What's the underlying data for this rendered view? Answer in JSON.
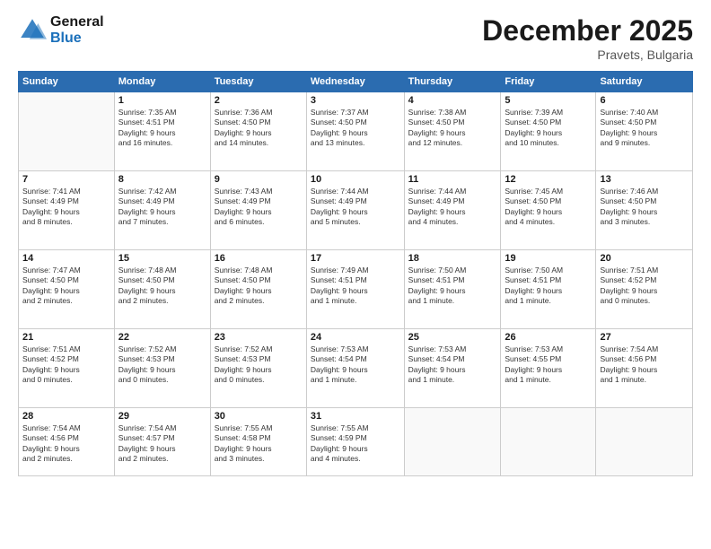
{
  "logo": {
    "line1": "General",
    "line2": "Blue"
  },
  "header": {
    "month_year": "December 2025",
    "location": "Pravets, Bulgaria"
  },
  "weekdays": [
    "Sunday",
    "Monday",
    "Tuesday",
    "Wednesday",
    "Thursday",
    "Friday",
    "Saturday"
  ],
  "weeks": [
    [
      {
        "day": "",
        "info": ""
      },
      {
        "day": "1",
        "info": "Sunrise: 7:35 AM\nSunset: 4:51 PM\nDaylight: 9 hours\nand 16 minutes."
      },
      {
        "day": "2",
        "info": "Sunrise: 7:36 AM\nSunset: 4:50 PM\nDaylight: 9 hours\nand 14 minutes."
      },
      {
        "day": "3",
        "info": "Sunrise: 7:37 AM\nSunset: 4:50 PM\nDaylight: 9 hours\nand 13 minutes."
      },
      {
        "day": "4",
        "info": "Sunrise: 7:38 AM\nSunset: 4:50 PM\nDaylight: 9 hours\nand 12 minutes."
      },
      {
        "day": "5",
        "info": "Sunrise: 7:39 AM\nSunset: 4:50 PM\nDaylight: 9 hours\nand 10 minutes."
      },
      {
        "day": "6",
        "info": "Sunrise: 7:40 AM\nSunset: 4:50 PM\nDaylight: 9 hours\nand 9 minutes."
      }
    ],
    [
      {
        "day": "7",
        "info": "Sunrise: 7:41 AM\nSunset: 4:49 PM\nDaylight: 9 hours\nand 8 minutes."
      },
      {
        "day": "8",
        "info": "Sunrise: 7:42 AM\nSunset: 4:49 PM\nDaylight: 9 hours\nand 7 minutes."
      },
      {
        "day": "9",
        "info": "Sunrise: 7:43 AM\nSunset: 4:49 PM\nDaylight: 9 hours\nand 6 minutes."
      },
      {
        "day": "10",
        "info": "Sunrise: 7:44 AM\nSunset: 4:49 PM\nDaylight: 9 hours\nand 5 minutes."
      },
      {
        "day": "11",
        "info": "Sunrise: 7:44 AM\nSunset: 4:49 PM\nDaylight: 9 hours\nand 4 minutes."
      },
      {
        "day": "12",
        "info": "Sunrise: 7:45 AM\nSunset: 4:50 PM\nDaylight: 9 hours\nand 4 minutes."
      },
      {
        "day": "13",
        "info": "Sunrise: 7:46 AM\nSunset: 4:50 PM\nDaylight: 9 hours\nand 3 minutes."
      }
    ],
    [
      {
        "day": "14",
        "info": "Sunrise: 7:47 AM\nSunset: 4:50 PM\nDaylight: 9 hours\nand 2 minutes."
      },
      {
        "day": "15",
        "info": "Sunrise: 7:48 AM\nSunset: 4:50 PM\nDaylight: 9 hours\nand 2 minutes."
      },
      {
        "day": "16",
        "info": "Sunrise: 7:48 AM\nSunset: 4:50 PM\nDaylight: 9 hours\nand 2 minutes."
      },
      {
        "day": "17",
        "info": "Sunrise: 7:49 AM\nSunset: 4:51 PM\nDaylight: 9 hours\nand 1 minute."
      },
      {
        "day": "18",
        "info": "Sunrise: 7:50 AM\nSunset: 4:51 PM\nDaylight: 9 hours\nand 1 minute."
      },
      {
        "day": "19",
        "info": "Sunrise: 7:50 AM\nSunset: 4:51 PM\nDaylight: 9 hours\nand 1 minute."
      },
      {
        "day": "20",
        "info": "Sunrise: 7:51 AM\nSunset: 4:52 PM\nDaylight: 9 hours\nand 0 minutes."
      }
    ],
    [
      {
        "day": "21",
        "info": "Sunrise: 7:51 AM\nSunset: 4:52 PM\nDaylight: 9 hours\nand 0 minutes."
      },
      {
        "day": "22",
        "info": "Sunrise: 7:52 AM\nSunset: 4:53 PM\nDaylight: 9 hours\nand 0 minutes."
      },
      {
        "day": "23",
        "info": "Sunrise: 7:52 AM\nSunset: 4:53 PM\nDaylight: 9 hours\nand 0 minutes."
      },
      {
        "day": "24",
        "info": "Sunrise: 7:53 AM\nSunset: 4:54 PM\nDaylight: 9 hours\nand 1 minute."
      },
      {
        "day": "25",
        "info": "Sunrise: 7:53 AM\nSunset: 4:54 PM\nDaylight: 9 hours\nand 1 minute."
      },
      {
        "day": "26",
        "info": "Sunrise: 7:53 AM\nSunset: 4:55 PM\nDaylight: 9 hours\nand 1 minute."
      },
      {
        "day": "27",
        "info": "Sunrise: 7:54 AM\nSunset: 4:56 PM\nDaylight: 9 hours\nand 1 minute."
      }
    ],
    [
      {
        "day": "28",
        "info": "Sunrise: 7:54 AM\nSunset: 4:56 PM\nDaylight: 9 hours\nand 2 minutes."
      },
      {
        "day": "29",
        "info": "Sunrise: 7:54 AM\nSunset: 4:57 PM\nDaylight: 9 hours\nand 2 minutes."
      },
      {
        "day": "30",
        "info": "Sunrise: 7:55 AM\nSunset: 4:58 PM\nDaylight: 9 hours\nand 3 minutes."
      },
      {
        "day": "31",
        "info": "Sunrise: 7:55 AM\nSunset: 4:59 PM\nDaylight: 9 hours\nand 4 minutes."
      },
      {
        "day": "",
        "info": ""
      },
      {
        "day": "",
        "info": ""
      },
      {
        "day": "",
        "info": ""
      }
    ]
  ]
}
